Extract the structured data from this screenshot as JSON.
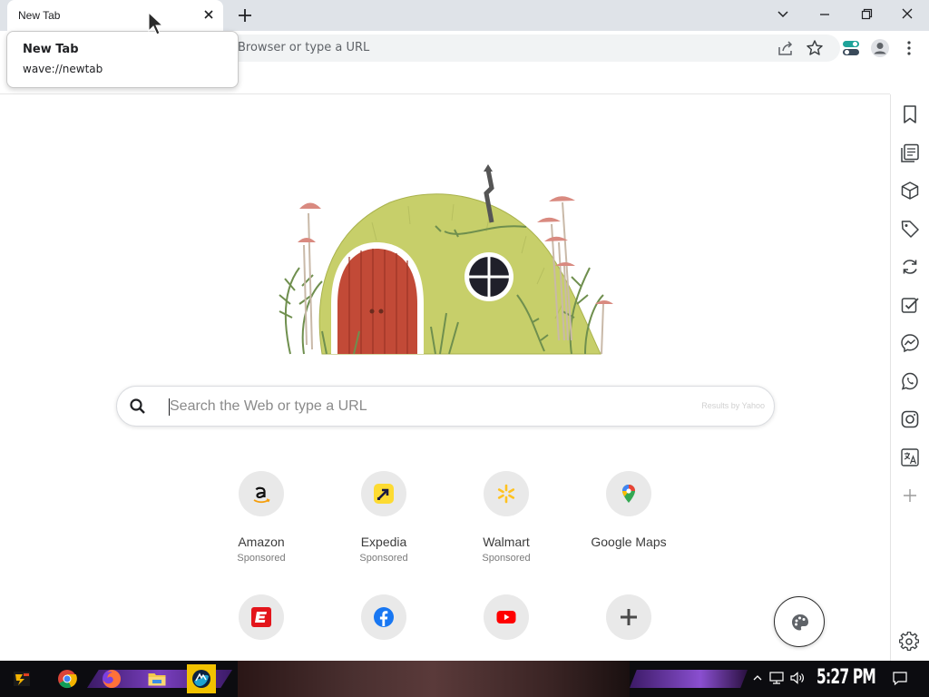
{
  "browser": {
    "tab": {
      "title": "New Tab"
    },
    "tooltip": {
      "title": "New Tab",
      "url": "wave://newtab"
    },
    "omnibox": {
      "text": "Browser or type a URL"
    }
  },
  "search": {
    "placeholder": "Search the Web or type a URL",
    "provider": "Results by Yahoo"
  },
  "tiles": [
    {
      "name": "Amazon",
      "sub": "Sponsored",
      "icon": "amazon-icon"
    },
    {
      "name": "Expedia",
      "sub": "Sponsored",
      "icon": "expedia-icon"
    },
    {
      "name": "Walmart",
      "sub": "Sponsored",
      "icon": "walmart-icon"
    },
    {
      "name": "Google Maps",
      "sub": "",
      "icon": "google-maps-icon"
    },
    {
      "name": "",
      "sub": "",
      "icon": "espn-icon"
    },
    {
      "name": "",
      "sub": "",
      "icon": "facebook-icon"
    },
    {
      "name": "",
      "sub": "",
      "icon": "youtube-icon"
    },
    {
      "name": "",
      "sub": "",
      "icon": "add-shortcut-icon"
    }
  ],
  "sidebar": {
    "icons": [
      "bookmark-icon",
      "reading-list-icon",
      "package-icon",
      "price-tag-icon",
      "sync-icon",
      "tasks-icon",
      "messenger-icon",
      "whatsapp-icon",
      "instagram-icon",
      "translate-icon",
      "add-icon"
    ]
  },
  "taskbar": {
    "clock": "5:27 PM",
    "apps": [
      "game-launcher-icon",
      "chrome-icon",
      "firefox-icon",
      "file-explorer-icon",
      "wave-browser-icon"
    ]
  },
  "colors": {
    "tabstrip": "#dfe3e8",
    "accent_teal": "#1fa39a",
    "youtube_red": "#ff0000",
    "facebook_blue": "#1877f2",
    "walmart_yellow": "#ffc220"
  }
}
